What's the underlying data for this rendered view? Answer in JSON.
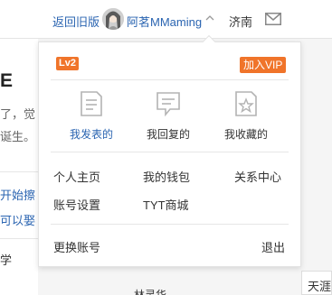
{
  "header": {
    "back_link": "返回旧版",
    "username": "阿茗MMaming",
    "city": "济南"
  },
  "background": {
    "big_letter": "E",
    "line1": "了，觉",
    "line2": "诞生。",
    "line3": "开始擦",
    "line4": "可以娶",
    "line5": "学",
    "right_box": "天涯",
    "bottom_text": "林灵华"
  },
  "dropdown": {
    "level_badge": "Lv2",
    "vip_button": "加入VIP",
    "actions": [
      {
        "label": "我发表的",
        "icon": "document-icon"
      },
      {
        "label": "我回复的",
        "icon": "comment-icon"
      },
      {
        "label": "我收藏的",
        "icon": "bookmark-star-icon"
      }
    ],
    "links": {
      "profile": "个人主页",
      "wallet": "我的钱包",
      "relations": "关系中心",
      "settings": "账号设置",
      "mall": "TYT商城",
      "switch_account": "更换账号",
      "logout": "退出"
    }
  },
  "colors": {
    "link_blue": "#2a64b1",
    "accent_orange": "#f0742a"
  }
}
